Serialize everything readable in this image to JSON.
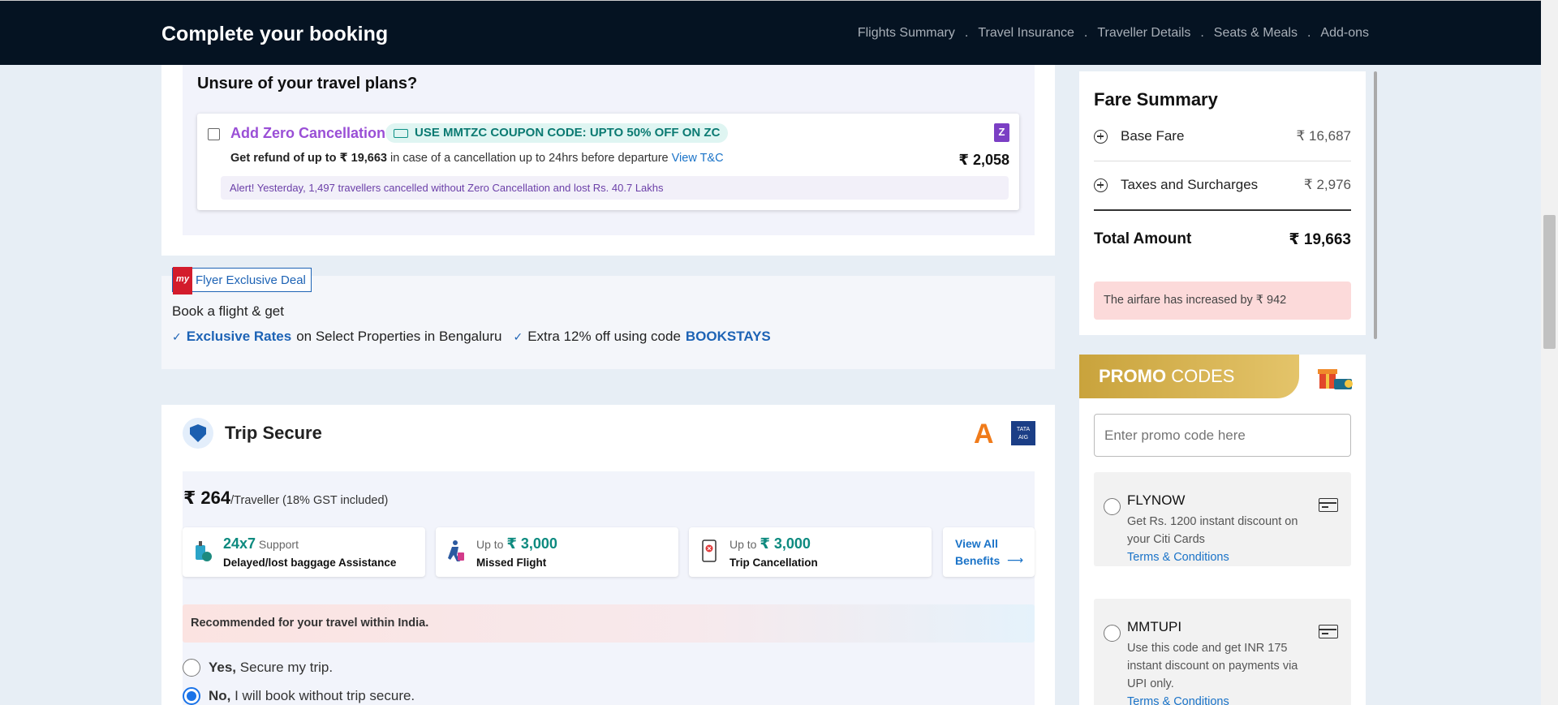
{
  "header": {
    "title": "Complete your booking",
    "steps": [
      "Flights Summary",
      "Travel Insurance",
      "Traveller Details",
      "Seats & Meals",
      "Add-ons"
    ],
    "separator": "."
  },
  "zero_cancellation": {
    "question": "Unsure of your travel plans?",
    "title": "Add Zero Cancellation",
    "coupon": "USE MMTZC COUPON CODE: UPTO 50% OFF ON ZC",
    "refund_prefix": "Get refund of up to ₹ 19,663",
    "refund_suffix": " in case of a cancellation up to 24hrs before departure ",
    "tnc_link": "View T&C",
    "price": "₹ 2,058",
    "logo_letter": "Z",
    "alert": "Alert! Yesterday, 1,497 travellers cancelled without Zero Cancellation and lost Rs. 40.7 Lakhs"
  },
  "flyer_deal": {
    "badge_logo": "my",
    "badge": "Flyer Exclusive Deal",
    "line1": "Book a flight & get",
    "item1_bold": "Exclusive Rates",
    "item1_rest": "on Select Properties in Bengaluru",
    "item2_rest": "Extra 12% off using code",
    "item2_code": "BOOKSTAYS",
    "check": "✓"
  },
  "trip_secure": {
    "title": "Trip Secure",
    "logo_acko": "A",
    "logo_tata": "TATA AIG",
    "price": "₹ 264",
    "price_suffix": "/Traveller (18% GST included)",
    "benefits": [
      {
        "prefix": "",
        "value": "24x7",
        "suffix": " Support",
        "label": "Delayed/lost baggage Assistance"
      },
      {
        "prefix": "Up to ",
        "value": "₹ 3,000",
        "suffix": "",
        "label": "Missed Flight"
      },
      {
        "prefix": "Up to ",
        "value": "₹ 3,000",
        "suffix": "",
        "label": "Trip Cancellation"
      }
    ],
    "view_all": "View All Benefits",
    "arrow": "⟶",
    "recommended": "Recommended for your travel within India.",
    "options": [
      {
        "bold": "Yes,",
        "text": " Secure my trip.",
        "selected": false
      },
      {
        "bold": "No,",
        "text": " I will book without trip secure.",
        "selected": true
      }
    ]
  },
  "fare_summary": {
    "title": "Fare Summary",
    "rows": [
      {
        "label": "Base Fare",
        "amount": "₹ 16,687"
      },
      {
        "label": "Taxes and Surcharges",
        "amount": "₹ 2,976"
      }
    ],
    "total_label": "Total Amount",
    "total_amount": "₹ 19,663",
    "increase_notice": "The airfare has increased by ₹ 942"
  },
  "promo": {
    "title_bold": "PROMO",
    "title_rest": " CODES",
    "placeholder": "Enter promo code here",
    "codes": [
      {
        "code": "FLYNOW",
        "desc": "Get Rs. 1200 instant discount on your Citi Cards",
        "link": "Terms & Conditions"
      },
      {
        "code": "MMTUPI",
        "desc": "Use this code and get INR 175 instant discount on payments via UPI only.",
        "link": "Terms & Conditions"
      }
    ]
  },
  "colors": {
    "header_bg": "#051322",
    "accent_blue": "#1a73c8",
    "zc_purple": "#9a4fd6",
    "teal": "#0d8a7f",
    "promo_gold": "#c9a33c"
  }
}
